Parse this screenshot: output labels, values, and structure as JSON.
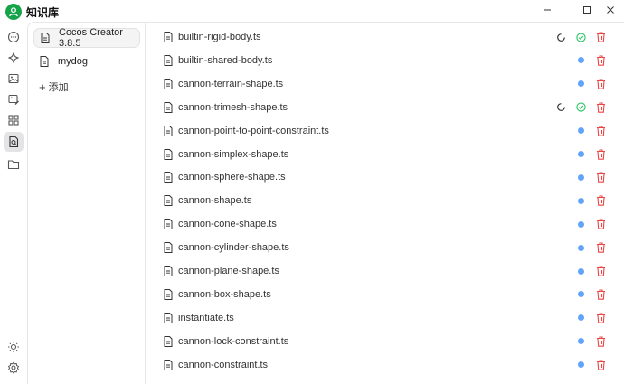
{
  "app": {
    "title": "知识库"
  },
  "colors": {
    "accent": "#16a34a",
    "status_blue": "#60a5fa",
    "danger": "#ef4444",
    "success": "#22c55e"
  },
  "sidebar_icons": [
    "chat-icon",
    "sparkle-icon",
    "image-icon",
    "image-edit-icon",
    "apps-icon",
    "knowledge-icon",
    "folder-icon",
    "sun-icon",
    "gear-icon"
  ],
  "knowledge_bases": [
    {
      "label": "Cocos Creator 3.8.5",
      "active": true
    },
    {
      "label": "mydog",
      "active": false
    }
  ],
  "add_label": "添加",
  "files": [
    {
      "name": "builtin-rigid-body.ts",
      "status": "processing"
    },
    {
      "name": "builtin-shared-body.ts",
      "status": "ready"
    },
    {
      "name": "cannon-terrain-shape.ts",
      "status": "ready"
    },
    {
      "name": "cannon-trimesh-shape.ts",
      "status": "processing"
    },
    {
      "name": "cannon-point-to-point-constraint.ts",
      "status": "ready"
    },
    {
      "name": "cannon-simplex-shape.ts",
      "status": "ready"
    },
    {
      "name": "cannon-sphere-shape.ts",
      "status": "ready"
    },
    {
      "name": "cannon-shape.ts",
      "status": "ready"
    },
    {
      "name": "cannon-cone-shape.ts",
      "status": "ready"
    },
    {
      "name": "cannon-cylinder-shape.ts",
      "status": "ready"
    },
    {
      "name": "cannon-plane-shape.ts",
      "status": "ready"
    },
    {
      "name": "cannon-box-shape.ts",
      "status": "ready"
    },
    {
      "name": "instantiate.ts",
      "status": "ready"
    },
    {
      "name": "cannon-lock-constraint.ts",
      "status": "ready"
    },
    {
      "name": "cannon-constraint.ts",
      "status": "ready"
    }
  ]
}
